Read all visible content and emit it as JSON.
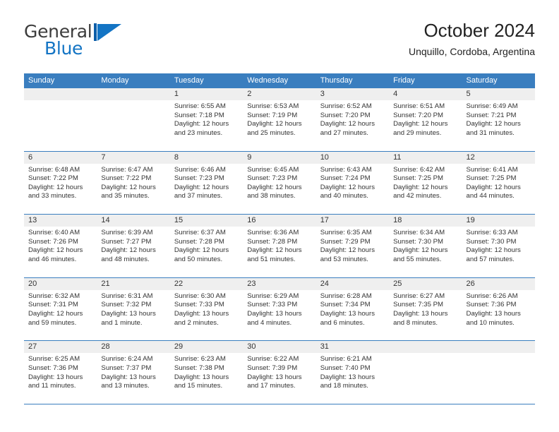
{
  "brand": {
    "name_part1": "General",
    "name_part2": "Blue",
    "mark_icon": "triangle-flag-icon",
    "accent_color": "#1374c4"
  },
  "header": {
    "title": "October 2024",
    "subtitle": "Unquillo, Cordoba, Argentina"
  },
  "calendar": {
    "header_bg": "#3a7ebf",
    "daynum_band_bg": "#efefef",
    "weekdays": [
      "Sunday",
      "Monday",
      "Tuesday",
      "Wednesday",
      "Thursday",
      "Friday",
      "Saturday"
    ],
    "weeks": [
      [
        {
          "day": "",
          "lines": []
        },
        {
          "day": "",
          "lines": []
        },
        {
          "day": "1",
          "lines": [
            "Sunrise: 6:55 AM",
            "Sunset: 7:18 PM",
            "Daylight: 12 hours",
            "and 23 minutes."
          ]
        },
        {
          "day": "2",
          "lines": [
            "Sunrise: 6:53 AM",
            "Sunset: 7:19 PM",
            "Daylight: 12 hours",
            "and 25 minutes."
          ]
        },
        {
          "day": "3",
          "lines": [
            "Sunrise: 6:52 AM",
            "Sunset: 7:20 PM",
            "Daylight: 12 hours",
            "and 27 minutes."
          ]
        },
        {
          "day": "4",
          "lines": [
            "Sunrise: 6:51 AM",
            "Sunset: 7:20 PM",
            "Daylight: 12 hours",
            "and 29 minutes."
          ]
        },
        {
          "day": "5",
          "lines": [
            "Sunrise: 6:49 AM",
            "Sunset: 7:21 PM",
            "Daylight: 12 hours",
            "and 31 minutes."
          ]
        }
      ],
      [
        {
          "day": "6",
          "lines": [
            "Sunrise: 6:48 AM",
            "Sunset: 7:22 PM",
            "Daylight: 12 hours",
            "and 33 minutes."
          ]
        },
        {
          "day": "7",
          "lines": [
            "Sunrise: 6:47 AM",
            "Sunset: 7:22 PM",
            "Daylight: 12 hours",
            "and 35 minutes."
          ]
        },
        {
          "day": "8",
          "lines": [
            "Sunrise: 6:46 AM",
            "Sunset: 7:23 PM",
            "Daylight: 12 hours",
            "and 37 minutes."
          ]
        },
        {
          "day": "9",
          "lines": [
            "Sunrise: 6:45 AM",
            "Sunset: 7:23 PM",
            "Daylight: 12 hours",
            "and 38 minutes."
          ]
        },
        {
          "day": "10",
          "lines": [
            "Sunrise: 6:43 AM",
            "Sunset: 7:24 PM",
            "Daylight: 12 hours",
            "and 40 minutes."
          ]
        },
        {
          "day": "11",
          "lines": [
            "Sunrise: 6:42 AM",
            "Sunset: 7:25 PM",
            "Daylight: 12 hours",
            "and 42 minutes."
          ]
        },
        {
          "day": "12",
          "lines": [
            "Sunrise: 6:41 AM",
            "Sunset: 7:25 PM",
            "Daylight: 12 hours",
            "and 44 minutes."
          ]
        }
      ],
      [
        {
          "day": "13",
          "lines": [
            "Sunrise: 6:40 AM",
            "Sunset: 7:26 PM",
            "Daylight: 12 hours",
            "and 46 minutes."
          ]
        },
        {
          "day": "14",
          "lines": [
            "Sunrise: 6:39 AM",
            "Sunset: 7:27 PM",
            "Daylight: 12 hours",
            "and 48 minutes."
          ]
        },
        {
          "day": "15",
          "lines": [
            "Sunrise: 6:37 AM",
            "Sunset: 7:28 PM",
            "Daylight: 12 hours",
            "and 50 minutes."
          ]
        },
        {
          "day": "16",
          "lines": [
            "Sunrise: 6:36 AM",
            "Sunset: 7:28 PM",
            "Daylight: 12 hours",
            "and 51 minutes."
          ]
        },
        {
          "day": "17",
          "lines": [
            "Sunrise: 6:35 AM",
            "Sunset: 7:29 PM",
            "Daylight: 12 hours",
            "and 53 minutes."
          ]
        },
        {
          "day": "18",
          "lines": [
            "Sunrise: 6:34 AM",
            "Sunset: 7:30 PM",
            "Daylight: 12 hours",
            "and 55 minutes."
          ]
        },
        {
          "day": "19",
          "lines": [
            "Sunrise: 6:33 AM",
            "Sunset: 7:30 PM",
            "Daylight: 12 hours",
            "and 57 minutes."
          ]
        }
      ],
      [
        {
          "day": "20",
          "lines": [
            "Sunrise: 6:32 AM",
            "Sunset: 7:31 PM",
            "Daylight: 12 hours",
            "and 59 minutes."
          ]
        },
        {
          "day": "21",
          "lines": [
            "Sunrise: 6:31 AM",
            "Sunset: 7:32 PM",
            "Daylight: 13 hours",
            "and 1 minute."
          ]
        },
        {
          "day": "22",
          "lines": [
            "Sunrise: 6:30 AM",
            "Sunset: 7:33 PM",
            "Daylight: 13 hours",
            "and 2 minutes."
          ]
        },
        {
          "day": "23",
          "lines": [
            "Sunrise: 6:29 AM",
            "Sunset: 7:33 PM",
            "Daylight: 13 hours",
            "and 4 minutes."
          ]
        },
        {
          "day": "24",
          "lines": [
            "Sunrise: 6:28 AM",
            "Sunset: 7:34 PM",
            "Daylight: 13 hours",
            "and 6 minutes."
          ]
        },
        {
          "day": "25",
          "lines": [
            "Sunrise: 6:27 AM",
            "Sunset: 7:35 PM",
            "Daylight: 13 hours",
            "and 8 minutes."
          ]
        },
        {
          "day": "26",
          "lines": [
            "Sunrise: 6:26 AM",
            "Sunset: 7:36 PM",
            "Daylight: 13 hours",
            "and 10 minutes."
          ]
        }
      ],
      [
        {
          "day": "27",
          "lines": [
            "Sunrise: 6:25 AM",
            "Sunset: 7:36 PM",
            "Daylight: 13 hours",
            "and 11 minutes."
          ]
        },
        {
          "day": "28",
          "lines": [
            "Sunrise: 6:24 AM",
            "Sunset: 7:37 PM",
            "Daylight: 13 hours",
            "and 13 minutes."
          ]
        },
        {
          "day": "29",
          "lines": [
            "Sunrise: 6:23 AM",
            "Sunset: 7:38 PM",
            "Daylight: 13 hours",
            "and 15 minutes."
          ]
        },
        {
          "day": "30",
          "lines": [
            "Sunrise: 6:22 AM",
            "Sunset: 7:39 PM",
            "Daylight: 13 hours",
            "and 17 minutes."
          ]
        },
        {
          "day": "31",
          "lines": [
            "Sunrise: 6:21 AM",
            "Sunset: 7:40 PM",
            "Daylight: 13 hours",
            "and 18 minutes."
          ]
        },
        {
          "day": "",
          "lines": []
        },
        {
          "day": "",
          "lines": []
        }
      ]
    ]
  }
}
